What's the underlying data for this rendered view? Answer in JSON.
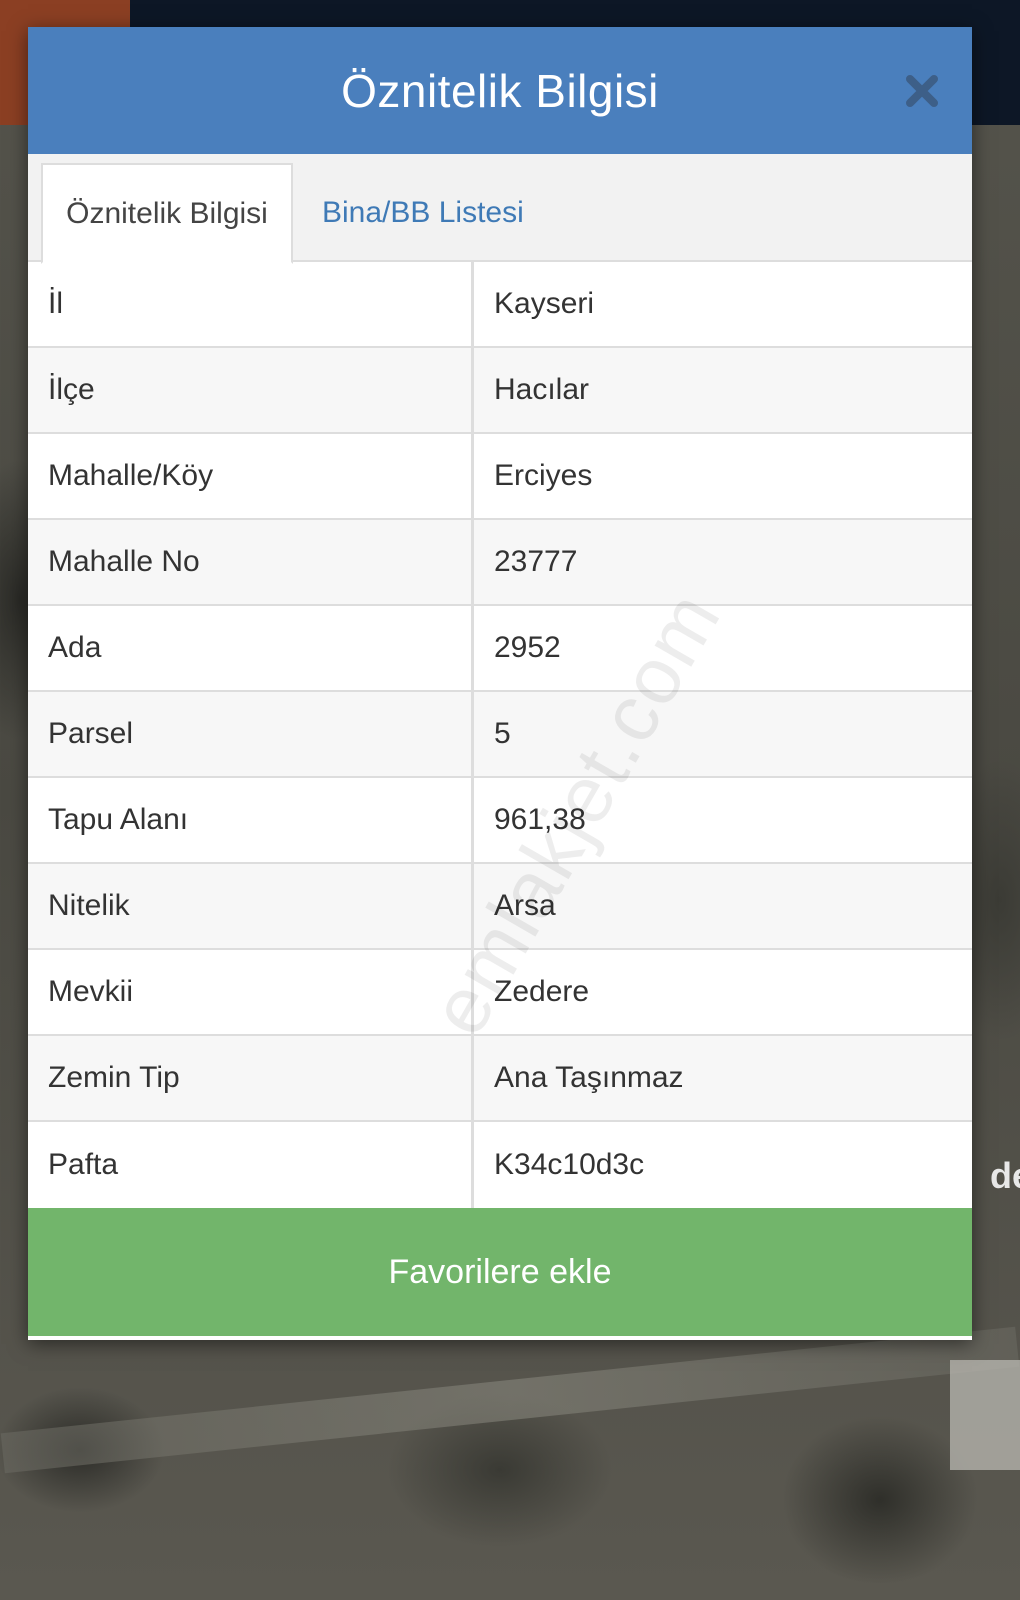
{
  "modal": {
    "title": "Öznitelik Bilgisi",
    "tabs": [
      {
        "label": "Öznitelik Bilgisi",
        "active": true
      },
      {
        "label": "Bina/BB Listesi",
        "active": false
      }
    ],
    "rows": [
      {
        "key": "İl",
        "value": "Kayseri"
      },
      {
        "key": "İlçe",
        "value": "Hacılar"
      },
      {
        "key": "Mahalle/Köy",
        "value": "Erciyes"
      },
      {
        "key": "Mahalle No",
        "value": "23777"
      },
      {
        "key": "Ada",
        "value": "2952"
      },
      {
        "key": "Parsel",
        "value": "5"
      },
      {
        "key": "Tapu Alanı",
        "value": "961,38"
      },
      {
        "key": "Nitelik",
        "value": "Arsa"
      },
      {
        "key": "Mevkii",
        "value": "Zedere"
      },
      {
        "key": "Zemin Tip",
        "value": "Ana Taşınmaz"
      },
      {
        "key": "Pafta",
        "value": "K34c10d3c"
      }
    ],
    "favorite_label": "Favorilere ekle",
    "close_icon": "close-icon"
  },
  "watermark": "emlakjet.com",
  "map_label": "de",
  "colors": {
    "header": "#4a7fbd",
    "favorite_button": "#72b56b",
    "tab_link": "#3f7ab6"
  }
}
